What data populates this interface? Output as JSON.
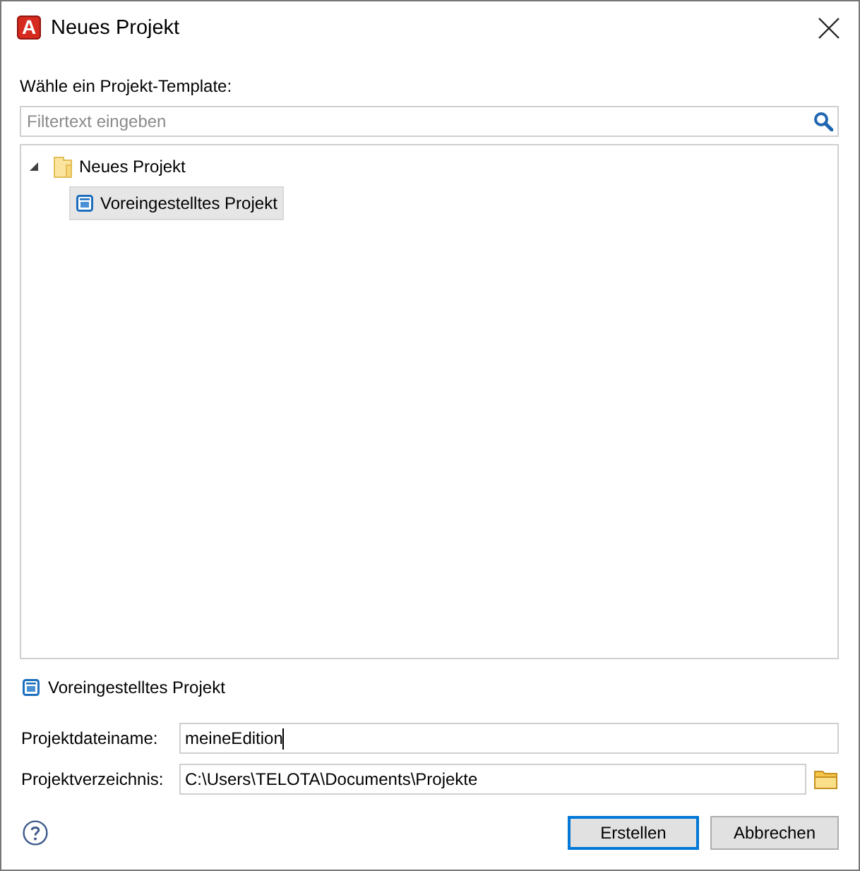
{
  "window": {
    "app_letter": "A",
    "title": "Neues Projekt"
  },
  "template_label": "Wähle ein Projekt-Template:",
  "filter": {
    "placeholder": "Filtertext eingeben"
  },
  "tree": [
    {
      "label": "Neues Projekt",
      "kind": "folder",
      "expanded": true,
      "selected": false,
      "children": [
        {
          "label": "Voreingestelltes Projekt",
          "kind": "project",
          "selected": true
        }
      ]
    }
  ],
  "description": "Voreingestelltes Projekt",
  "fields": [
    {
      "label": "Projektdateiname:",
      "value": "meineEdition",
      "focused": true,
      "browse": false
    },
    {
      "label": "Projektverzeichnis:",
      "value": "C:\\Users\\TELOTA\\Documents\\Projekte",
      "focused": false,
      "browse": true
    }
  ],
  "buttons": [
    {
      "label": "Erstellen",
      "default": true
    },
    {
      "label": "Abbrechen",
      "default": false
    }
  ]
}
